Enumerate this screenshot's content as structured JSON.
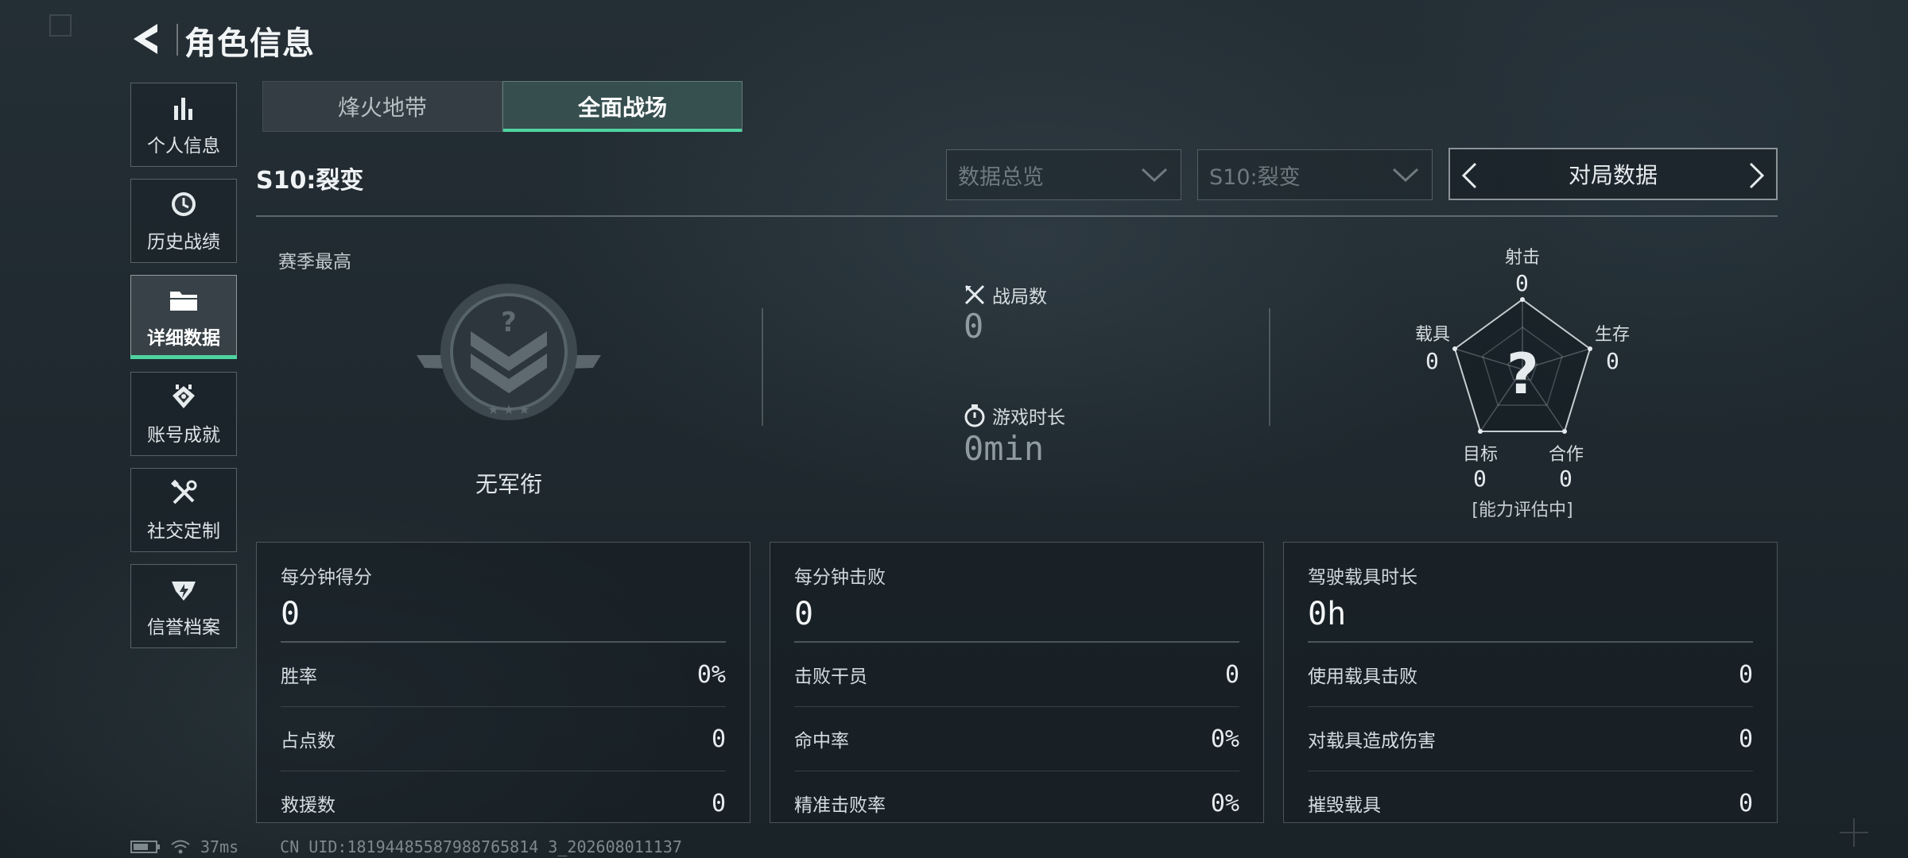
{
  "header": {
    "title": "角色信息"
  },
  "sidebar": {
    "items": [
      {
        "label": "个人信息",
        "icon": "bar-chart-icon"
      },
      {
        "label": "历史战绩",
        "icon": "clock-icon"
      },
      {
        "label": "详细数据",
        "icon": "folder-icon",
        "active": true
      },
      {
        "label": "账号成就",
        "icon": "medal-icon"
      },
      {
        "label": "社交定制",
        "icon": "tools-icon"
      },
      {
        "label": "信誉档案",
        "icon": "credit-badge-icon"
      }
    ]
  },
  "tabs": [
    {
      "label": "烽火地带",
      "active": false
    },
    {
      "label": "全面战场",
      "active": true
    }
  ],
  "season": {
    "title": "S10:裂变"
  },
  "filters": {
    "overview_select": "数据总览",
    "season_select": "S10:裂变",
    "match_selector": "对局数据"
  },
  "rank": {
    "section_label": "赛季最高",
    "name": "无军衔"
  },
  "summary": {
    "matches_label": "战局数",
    "matches_value": "0",
    "playtime_label": "游戏时长",
    "playtime_value": "0min"
  },
  "radar": {
    "shoot_label": "射击",
    "shoot_value": "0",
    "survive_label": "生存",
    "survive_value": "0",
    "coop_label": "合作",
    "coop_value": "0",
    "target_label": "目标",
    "target_value": "0",
    "vehicle_label": "载具",
    "vehicle_value": "0",
    "center_mark": "?",
    "note": "[能力评估中]"
  },
  "cards": [
    {
      "title": "每分钟得分",
      "big": "0",
      "rows": [
        {
          "label": "胜率",
          "value": "0%"
        },
        {
          "label": "占点数",
          "value": "0"
        },
        {
          "label": "救援数",
          "value": "0"
        }
      ]
    },
    {
      "title": "每分钟击败",
      "big": "0",
      "rows": [
        {
          "label": "击败干员",
          "value": "0"
        },
        {
          "label": "命中率",
          "value": "0%"
        },
        {
          "label": "精准击败率",
          "value": "0%"
        }
      ]
    },
    {
      "title": "驾驶载具时长",
      "big": "0h",
      "rows": [
        {
          "label": "使用载具击败",
          "value": "0"
        },
        {
          "label": "对载具造成伤害",
          "value": "0"
        },
        {
          "label": "摧毁载具",
          "value": "0"
        }
      ]
    }
  ],
  "footer": {
    "ping": "37ms",
    "uid": "CN UID:18194485587988765814 3_202608011137"
  },
  "colors": {
    "accent": "#4fd3a0"
  }
}
